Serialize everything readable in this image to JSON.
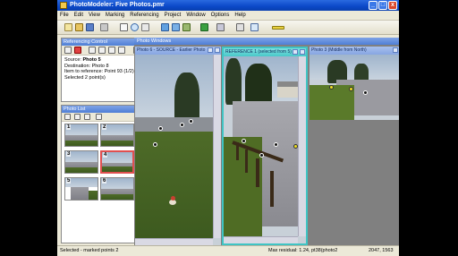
{
  "window": {
    "title": "PhotoModeler: Five Photos.pmr",
    "minimize": "_",
    "maximize": "□",
    "close": "x"
  },
  "menu": [
    "File",
    "Edit",
    "View",
    "Marking",
    "Referencing",
    "Project",
    "Window",
    "Options",
    "Help"
  ],
  "toolbar": {
    "icons": [
      "new-project-icon",
      "open-icon",
      "save-icon",
      "undo-icon",
      "pointer-icon",
      "zoom-icon",
      "pan-icon",
      "mark-point-icon",
      "mark-line-icon",
      "referencing-icon",
      "measure-icon",
      "view-icon",
      "dropdown-icon",
      "3d-view-icon",
      "edge-icon"
    ]
  },
  "referencing_control": {
    "title": "Referencing Control",
    "close": "x",
    "source_label": "Source:",
    "source_value": "Photo 5",
    "destination_label": "Destination:",
    "destination_value": "Photo 8",
    "item_label": "Item to reference:",
    "item_value": "Point 93  (1/2)",
    "selected_text": "Selected 2 point(s)"
  },
  "photo_list": {
    "title": "Photo List",
    "close": "x",
    "thumbs": [
      {
        "num": "1",
        "selected": false
      },
      {
        "num": "2",
        "selected": false
      },
      {
        "num": "3",
        "selected": false
      },
      {
        "num": "4",
        "selected": true
      },
      {
        "num": "5",
        "selected": false
      },
      {
        "num": "6",
        "selected": false
      }
    ]
  },
  "photo_windows": {
    "title": "Photo Windows",
    "panels": [
      {
        "title": "Photo 6 - SOURCE - Earlier Photo",
        "kind": "source"
      },
      {
        "title": "REFERENCE 1 (selected from 5)",
        "kind": "ref"
      },
      {
        "title": "Photo 3 (Middle from North)",
        "kind": "normal"
      }
    ]
  },
  "status": {
    "left": "Selected - marked points 2",
    "residual": "Max residual: 1.24, pt38(photo2",
    "coords": "2047, 1563"
  },
  "colors": {
    "titlebar": "#0b48c8",
    "reference_border": "#3fc4c4",
    "selected_thumb": "#e05050"
  }
}
